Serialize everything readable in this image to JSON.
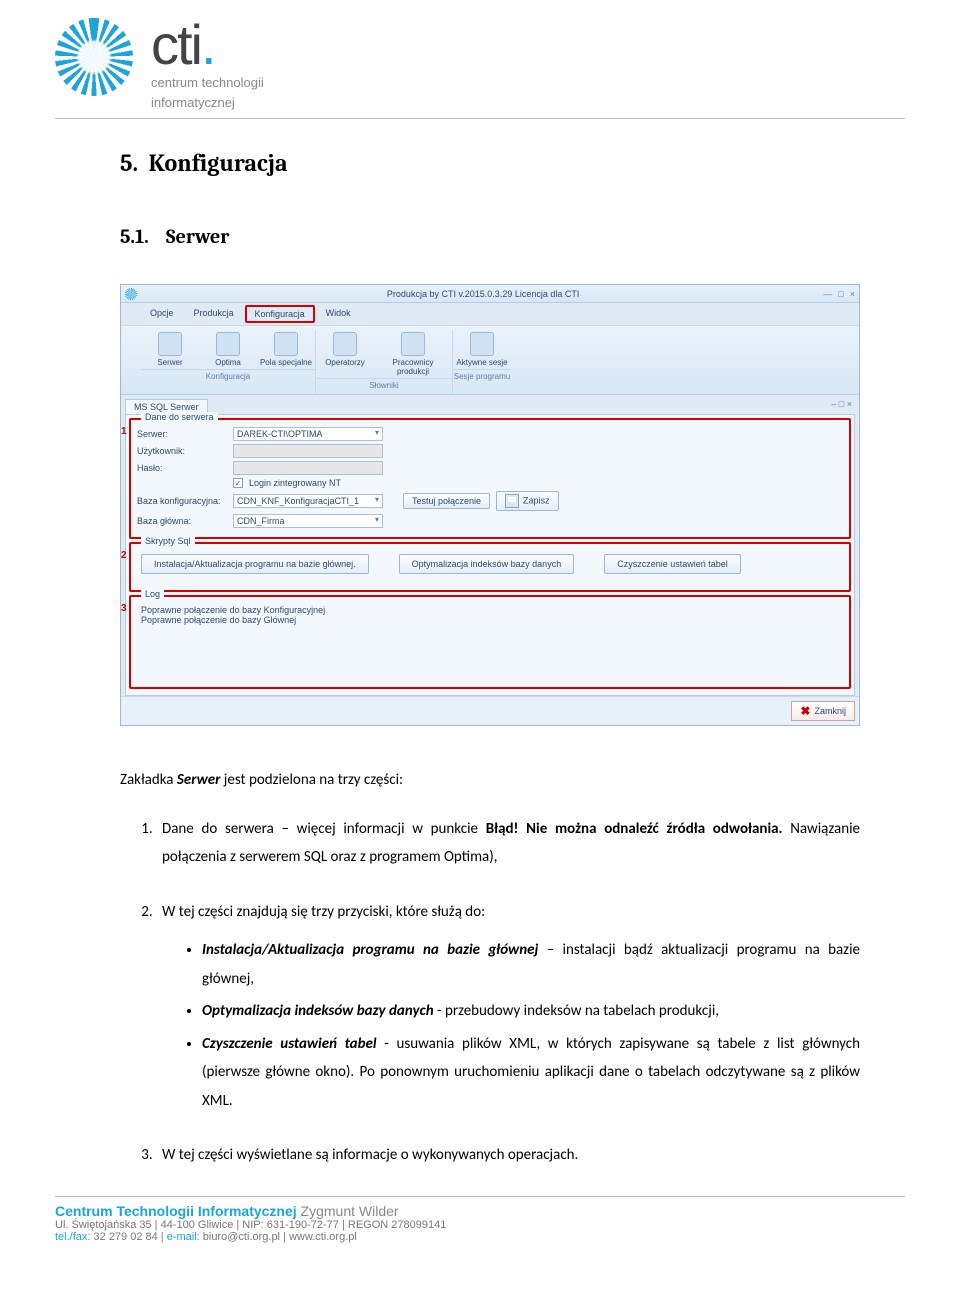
{
  "logo": {
    "letters": "cti",
    "sub1": "centrum technologii",
    "sub2": "informatycznej"
  },
  "section": {
    "num": "5.",
    "title": "Konfiguracja"
  },
  "subsection": {
    "num": "5.1.",
    "title": "Serwer"
  },
  "app": {
    "title": "Produkcja by CTI v.2015.0.3.29 Licencja dla CTI",
    "window_controls": {
      "min": "—",
      "max": "□",
      "close": "×"
    },
    "menu": {
      "opcje": "Opcje",
      "produkcja": "Produkcja",
      "konfiguracja": "Konfiguracja",
      "widok": "Widok"
    },
    "ribbon": {
      "group_config": "Konfiguracja",
      "group_dict": "Słowniki",
      "group_session": "Sesje programu",
      "btn_serwer": "Serwer",
      "btn_optima": "Optima",
      "btn_pola": "Pola specjalne",
      "btn_operatorzy": "Operatorzy",
      "btn_pracownicy": "Pracownicy produkcji",
      "btn_aktywne": "Aktywne sesje"
    },
    "subtab": {
      "label": "MS SQL Serwer",
      "close_tabs": "– □ ×"
    },
    "fs1": {
      "legend": "Dane do serwera",
      "marker": "1",
      "serwer_lbl": "Serwer:",
      "serwer_val": "DAREK-CTI\\OPTIMA",
      "user_lbl": "Użytkownik:",
      "pass_lbl": "Hasło:",
      "login_nt": "Login zintegrowany NT",
      "baza_konf_lbl": "Baza konfiguracyjna:",
      "baza_konf_val": "CDN_KNF_KonfiguracjaCTI_1",
      "baza_gl_lbl": "Baza główna:",
      "baza_gl_val": "CDN_Firma",
      "btn_test": "Testuj połączenie",
      "btn_save": "Zapisz"
    },
    "fs2": {
      "legend": "Skrypty Sql",
      "marker": "2",
      "btn_install": "Instalacja/Aktualizacja programu na bazie głównej.",
      "btn_opt": "Optymalizacja indeksów bazy danych",
      "btn_clean": "Czyszczenie ustawień tabel"
    },
    "fs3": {
      "legend": "Log",
      "marker": "3",
      "line1": "Poprawne połączenie do bazy Konfiguracyjnej",
      "line2": "Poprawne połączenie do bazy Głównej"
    },
    "close_btn": "Zamknij"
  },
  "body": {
    "intro_pre": "Zakładka ",
    "intro_bold": "Serwer",
    "intro_post": " jest podzielona na trzy części:",
    "li1_pre": "Dane do serwera – więcej informacji w punkcie ",
    "li1_err": "Błąd! Nie można odnaleźć źródła odwołania.",
    "li1_post": " Nawiązanie połączenia z serwerem SQL oraz z programem Optima),",
    "li2_intro": "W tej części znajdują się trzy przyciski, które służą do:",
    "b1_bold": "Instalacja/Aktualizacja programu na bazie głównej",
    "b1_rest": " – instalacji bądź aktualizacji programu na bazie głównej,",
    "b2_bold": "Optymalizacja indeksów bazy danych",
    "b2_rest": " - przebudowy indeksów na tabelach produkcji,",
    "b3_bold": "Czyszczenie ustawień tabel",
    "b3_rest": " - usuwania plików XML, w których zapisywane są tabele z list głównych (pierwsze główne okno). Po ponownym uruchomieniu aplikacji dane o tabelach odczytywane są z plików XML.",
    "li3": "W tej części wyświetlane są informacje o wykonywanych operacjach."
  },
  "footer": {
    "company": "Centrum Technologii Informatycznej",
    "author": " Zygmunt Wilder",
    "addr": "Ul. Świętojańska 35 | 44-100 Gliwice | NIP: 631-190-72-77 | REGON 278099141",
    "tel_lbl": "tel./fax:",
    "tel": " 32 279 02 84 | ",
    "email_lbl": "e-mail:",
    "email": " biuro@cti.org.pl | www.cti.org.pl"
  }
}
